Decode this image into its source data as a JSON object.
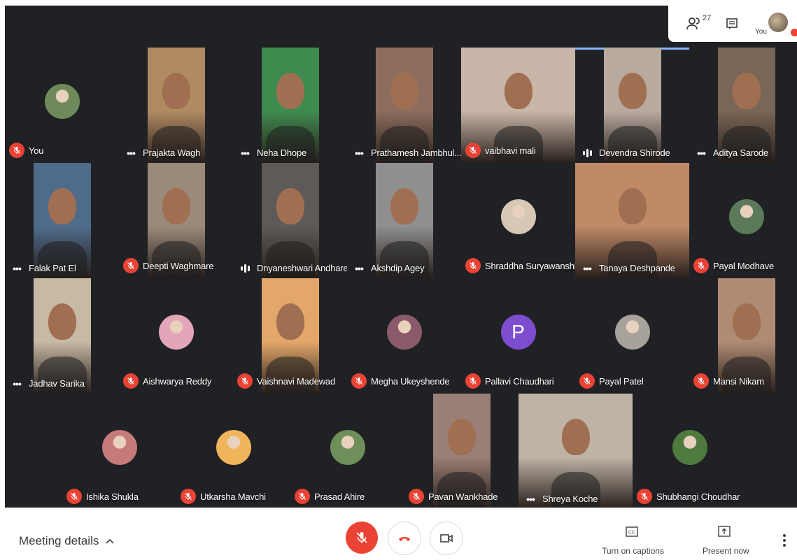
{
  "topbar": {
    "participant_count": "27",
    "self_label": "You"
  },
  "participants": [
    {
      "name": "You",
      "status": "muted",
      "tile": "avatar",
      "bg": "#202124",
      "avatar_color": "#6e8a5a"
    },
    {
      "name": "Prajakta Wagh",
      "status": "dots",
      "tile": "video",
      "vid_color": "#b08a63"
    },
    {
      "name": "Neha Dhope",
      "status": "dots",
      "tile": "video",
      "vid_color": "#3f8a4e"
    },
    {
      "name": "Prathamesh Jambhul...",
      "status": "dots",
      "tile": "video",
      "vid_color": "#8d6e5e"
    },
    {
      "name": "vaibhavi mali",
      "status": "muted",
      "tile": "video",
      "vid_color": "#c9b6a8"
    },
    {
      "name": "Devendra Shirode",
      "status": "talking",
      "tile": "video",
      "vid_color": "#b9aaa0"
    },
    {
      "name": "Aditya Sarode",
      "status": "dots",
      "tile": "video",
      "vid_color": "#7a6656"
    },
    {
      "name": "Falak Pat El",
      "status": "dots",
      "tile": "video",
      "vid_color": "#4f6b8a"
    },
    {
      "name": "Deepti Waghmare",
      "status": "muted",
      "tile": "video",
      "vid_color": "#9b8a7a"
    },
    {
      "name": "Dnyaneshwari Andhare",
      "status": "talking",
      "tile": "video",
      "vid_color": "#5e5a57"
    },
    {
      "name": "Akshdip Agey",
      "status": "dots",
      "tile": "video",
      "vid_color": "#8f8f8f"
    },
    {
      "name": "Shraddha Suryawanshi",
      "status": "muted",
      "tile": "avatar",
      "avatar_color": "#d7c7b5"
    },
    {
      "name": "Tanaya Deshpande",
      "status": "dots",
      "tile": "video",
      "vid_color": "#c08a68"
    },
    {
      "name": "Payal Modhave",
      "status": "muted",
      "tile": "avatar",
      "avatar_color": "#5b7a5a"
    },
    {
      "name": "Jadhav Sarika",
      "status": "dots",
      "tile": "video",
      "vid_color": "#c7b9a4"
    },
    {
      "name": "Aishwarya Reddy",
      "status": "muted",
      "tile": "avatar",
      "avatar_color": "#e2a6b8"
    },
    {
      "name": "Vaishnavi Madewad",
      "status": "muted",
      "tile": "video",
      "vid_color": "#e3a76a"
    },
    {
      "name": "Megha Ukeyshende",
      "status": "muted",
      "tile": "avatar",
      "avatar_color": "#8a5a6a"
    },
    {
      "name": "Pallavi Chaudhari",
      "status": "muted",
      "tile": "letter",
      "letter": "P",
      "avatar_color": "#7c4dce"
    },
    {
      "name": "Payal Patel",
      "status": "muted",
      "tile": "avatar",
      "avatar_color": "#a7a39b"
    },
    {
      "name": "Mansi Nikam",
      "status": "muted",
      "tile": "video",
      "vid_color": "#b08b73"
    },
    {
      "name": "Ishika Shukla",
      "status": "muted",
      "tile": "avatar",
      "avatar_color": "#c77a7a"
    },
    {
      "name": "Utkarsha Mavchi",
      "status": "muted",
      "tile": "avatar",
      "avatar_color": "#f0b45a"
    },
    {
      "name": "Prasad Ahire",
      "status": "muted",
      "tile": "avatar",
      "avatar_color": "#6f8f5a"
    },
    {
      "name": "Pavan Wankhade",
      "status": "muted",
      "tile": "video",
      "vid_color": "#9a7f76"
    },
    {
      "name": "Shreya Koche",
      "status": "dots",
      "tile": "video",
      "vid_color": "#bfb3a6"
    },
    {
      "name": "Shubhangi Choudhar",
      "status": "muted",
      "tile": "avatar",
      "avatar_color": "#4f7a3e"
    }
  ],
  "bottombar": {
    "meeting_details": "Meeting details",
    "captions_label": "Turn on captions",
    "present_label": "Present now"
  },
  "colors": {
    "mute_red": "#ea4335",
    "stage_bg": "#202124",
    "active_border": "#8ab4f8"
  }
}
